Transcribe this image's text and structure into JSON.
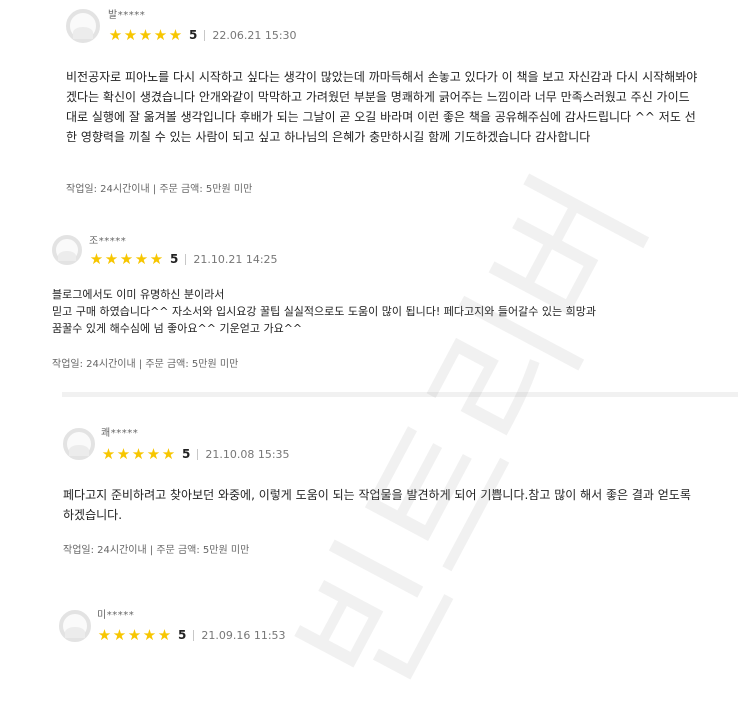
{
  "reviews": [
    {
      "reviewer": "발*****",
      "score": "5",
      "date": "22.06.21 15:30",
      "body": "비전공자로 피아노를 다시 시작하고 싶다는 생각이 많았는데 까마득해서  손놓고 있다가 이 책을 보고 자신감과 다시 시작해봐야겠다는 확신이 생겼습니다 안개와같이 막막하고 가려웠던 부분을 명쾌하게 긁어주는 느낌이라 너무 만족스러웠고 주신 가이드대로 실행에 잘 옮겨볼 생각입니다 후배가 되는 그날이 곧 오길 바라며 이런 좋은 책을 공유해주심에 감사드립니다 ^^ 저도 선한 영향력을 끼칠 수 있는 사람이 되고 싶고 하나님의 은혜가 충만하시길 함께 기도하겠습니다 감사합니다",
      "meta": "작업일: 24시간이내 | 주문 금액: 5만원 미만"
    },
    {
      "reviewer": "조*****",
      "score": "5",
      "date": "21.10.21 14:25",
      "body": "블로그에서도 이미 유명하신 분이라서\n믿고 구매 하였습니다^^ 자소서와 입시요강 꿀팁 실실적으로도 도움이 많이 됩니다! 페다고지와 들어갈수 있는 희망과\n꿈꿀수 있게 해수심에 넘 좋아요^^ 기운얻고 가요^^",
      "meta": "작업일: 24시간이내 | 주문 금액: 5만원 미만"
    },
    {
      "reviewer": "쾌*****",
      "score": "5",
      "date": "21.10.08 15:35",
      "body": "페다고지 준비하려고 찾아보던 와중에, 이렇게 도움이 되는 작업물을 발견하게 되어 기쁩니다.참고 많이 해서 좋은 결과 얻도록 하겠습니다.",
      "meta": "작업일: 24시간이내 | 주문 금액: 5만원 미만"
    },
    {
      "reviewer": "미*****",
      "score": "5",
      "date": "21.09.16 11:53",
      "body": "",
      "meta": ""
    }
  ],
  "watermark": "빈트리버",
  "colors": {
    "star": "#f7c600",
    "divider": "#f1f1f1",
    "avatar_border": "#e3e3e3"
  },
  "icons": {
    "avatar": "user-avatar-icon",
    "star": "star-icon"
  }
}
